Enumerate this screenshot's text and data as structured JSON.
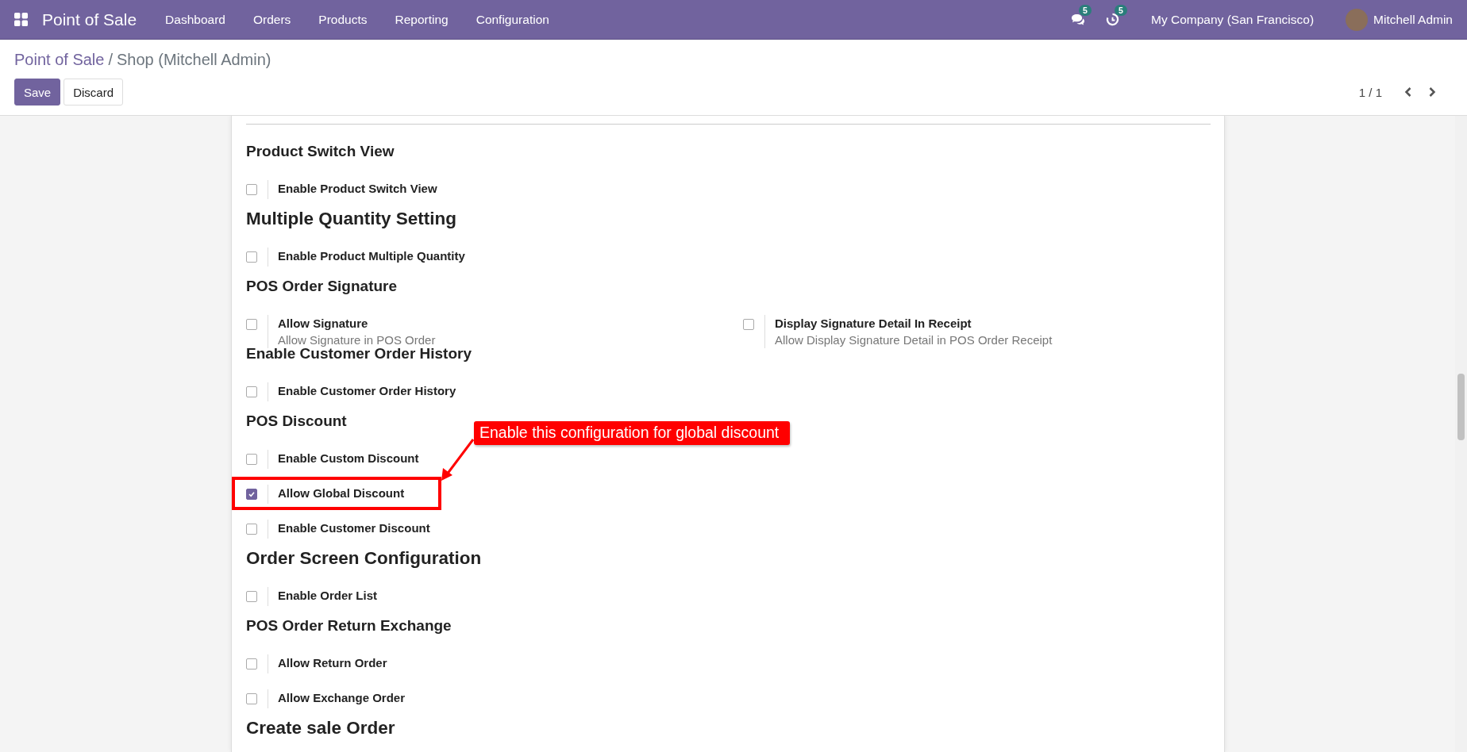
{
  "navbar": {
    "app_name": "Point of Sale",
    "menu": [
      "Dashboard",
      "Orders",
      "Products",
      "Reporting",
      "Configuration"
    ],
    "messages_badge": "5",
    "activities_badge": "5",
    "company": "My Company (San Francisco)",
    "user": "Mitchell Admin"
  },
  "breadcrumb": {
    "parent": "Point of Sale",
    "separator": "/",
    "current": "Shop (Mitchell Admin)"
  },
  "buttons": {
    "save": "Save",
    "discard": "Discard"
  },
  "pager": {
    "value": "1 / 1"
  },
  "sections": [
    {
      "title": "Product Switch View",
      "kind": "minor",
      "settings": [
        {
          "label": "Enable Product Switch View",
          "checked": false,
          "highlighted": false
        }
      ]
    },
    {
      "title": "Multiple Quantity Setting",
      "kind": "major",
      "settings": [
        {
          "label": "Enable Product Multiple Quantity",
          "checked": false,
          "highlighted": false
        }
      ]
    },
    {
      "title": "POS Order Signature",
      "kind": "minor",
      "settings": [
        {
          "label": "Allow Signature",
          "description": "Allow Signature in POS Order",
          "checked": false,
          "highlighted": false
        },
        {
          "label": "Display Signature Detail In Receipt",
          "description": "Allow Display Signature Detail in POS Order Receipt",
          "checked": false,
          "highlighted": false
        }
      ]
    },
    {
      "title": "Enable Customer Order History",
      "kind": "minor",
      "settings": [
        {
          "label": "Enable Customer Order History",
          "checked": false,
          "highlighted": false
        }
      ]
    },
    {
      "title": "POS Discount",
      "kind": "minor",
      "settings": [
        {
          "label": "Enable Custom Discount",
          "checked": false,
          "highlighted": false
        },
        {
          "label": "Allow Global Discount",
          "checked": true,
          "highlighted": true
        },
        {
          "label": "Enable Customer Discount",
          "checked": false,
          "highlighted": false
        }
      ]
    },
    {
      "title": "Order Screen Configuration",
      "kind": "major",
      "settings": [
        {
          "label": "Enable Order List",
          "checked": false,
          "highlighted": false
        }
      ]
    },
    {
      "title": "POS Order Return Exchange",
      "kind": "minor",
      "settings": [
        {
          "label": "Allow Return Order",
          "checked": false,
          "highlighted": false
        },
        {
          "label": "Allow Exchange Order",
          "checked": false,
          "highlighted": false
        }
      ]
    },
    {
      "title": "Create sale Order",
      "kind": "major"
    }
  ],
  "annotation": {
    "text": "Enable this configuration for global discount"
  }
}
